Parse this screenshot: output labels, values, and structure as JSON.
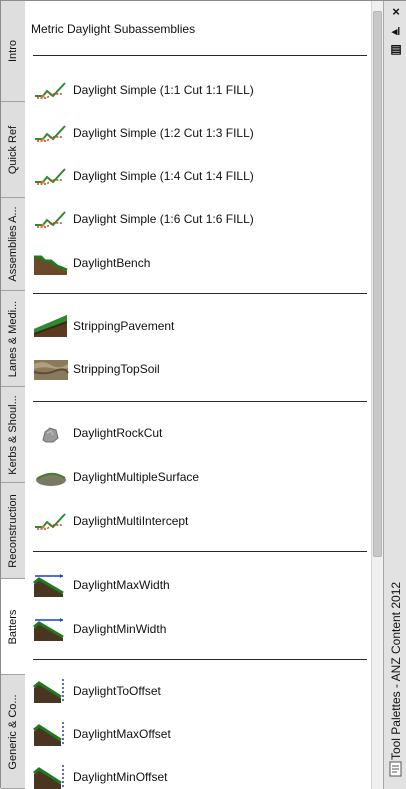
{
  "tabs": [
    {
      "label": "Intro"
    },
    {
      "label": "Quick Ref"
    },
    {
      "label": "Assemblies A..."
    },
    {
      "label": "Lanes & Medi..."
    },
    {
      "label": "Kerbs & Shoul..."
    },
    {
      "label": "Reconstruction"
    },
    {
      "label": "Batters"
    },
    {
      "label": "Generic & Co..."
    }
  ],
  "palette": {
    "header": "Metric Daylight Subassemblies",
    "tools": [
      {
        "label": "Daylight Simple (1:1 Cut 1:1 FILL)",
        "icon": "daylight-simple-icon"
      },
      {
        "label": "Daylight Simple (1:2 Cut 1:3 FILL)",
        "icon": "daylight-simple-icon"
      },
      {
        "label": "Daylight Simple (1:4 Cut 1:4 FILL)",
        "icon": "daylight-simple-icon"
      },
      {
        "label": "Daylight Simple (1:6 Cut 1:6 FILL)",
        "icon": "daylight-simple-icon"
      },
      {
        "label": "DaylightBench",
        "icon": "daylight-bench-icon"
      },
      {
        "label": "StrippingPavement",
        "icon": "stripping-pavement-icon"
      },
      {
        "label": "StrippingTopSoil",
        "icon": "stripping-topsoil-icon"
      },
      {
        "label": "DaylightRockCut",
        "icon": "rock-cut-icon"
      },
      {
        "label": "DaylightMultipleSurface",
        "icon": "multiple-surface-icon"
      },
      {
        "label": "DaylightMultiIntercept",
        "icon": "daylight-simple-icon"
      },
      {
        "label": "DaylightMaxWidth",
        "icon": "max-width-icon"
      },
      {
        "label": "DaylightMinWidth",
        "icon": "min-width-icon"
      },
      {
        "label": "DaylightToOffset",
        "icon": "to-offset-icon"
      },
      {
        "label": "DaylightMaxOffset",
        "icon": "max-offset-icon"
      },
      {
        "label": "DaylightMinOffset",
        "icon": "min-offset-icon"
      }
    ]
  },
  "titlebar": {
    "title": "Tool Palettes - ANZ Content 2012",
    "close": "×",
    "autohide": "◂ǀ",
    "properties": "▤"
  }
}
